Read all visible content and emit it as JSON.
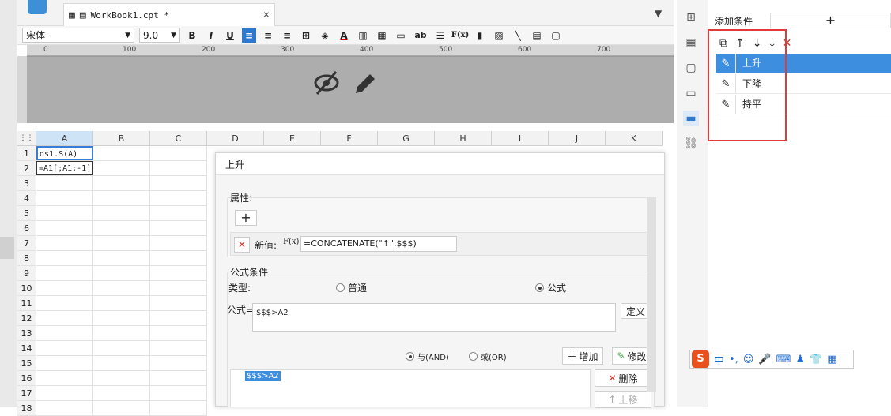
{
  "tab": {
    "title": "WorkBook1.cpt *",
    "close": "×"
  },
  "toolbar": {
    "font": "宋体",
    "size": "9.0",
    "bold": "B",
    "italic": "I",
    "underline": "U",
    "ab": "ab",
    "fx": "F(x)"
  },
  "ruler": {
    "ticks": [
      "0",
      "100",
      "200",
      "300",
      "400",
      "500",
      "600",
      "700"
    ]
  },
  "grid": {
    "columns": [
      "A",
      "B",
      "C",
      "D",
      "E",
      "F",
      "G",
      "H",
      "I",
      "J",
      "K"
    ],
    "rows": [
      "1",
      "2",
      "3",
      "4",
      "5",
      "6",
      "7",
      "8",
      "9",
      "10",
      "11",
      "12",
      "13",
      "14",
      "15",
      "16",
      "17",
      "18"
    ],
    "a1": "ds1.S(A)",
    "a2": "=A1[;A1:-1]"
  },
  "dialog": {
    "title": "上升",
    "attr_label": "属性:",
    "add_symbol": "+",
    "new_value_label": "新值:",
    "fx_label": "F(x)",
    "new_value": "=CONCATENATE(\"↑\",$$$)",
    "formula_section": "公式条件",
    "type_label": "类型:",
    "type_normal": "普通",
    "type_formula": "公式",
    "formula_label": "公式=",
    "formula_value": "$$$>A2",
    "define_btn": "定义",
    "and_label": "与(AND)",
    "or_label": "或(OR)",
    "add_btn": "增加",
    "modify_btn": "修改",
    "delete_btn": "删除",
    "move_up_btn": "上移",
    "condition_item": "$$$>A2"
  },
  "right_panel": {
    "add_condition_label": "添加条件",
    "add_symbol": "+",
    "items": [
      {
        "label": "上升",
        "selected": true
      },
      {
        "label": "下降",
        "selected": false
      },
      {
        "label": "持平",
        "selected": false
      }
    ]
  },
  "ime": {
    "label": "中"
  },
  "colors": {
    "accent": "#3e8ee0",
    "highlight_box": "#e03a3a",
    "delete_red": "#d9302c",
    "header_gray": "#adadad"
  }
}
